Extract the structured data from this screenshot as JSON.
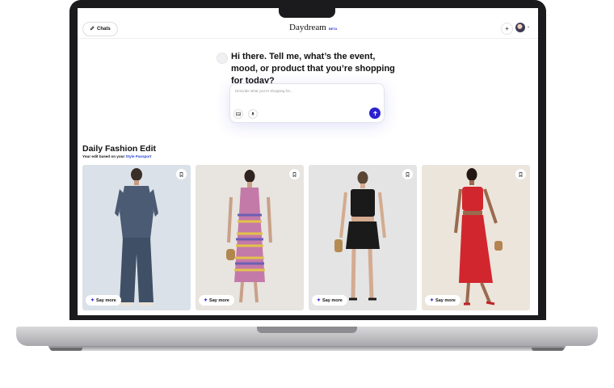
{
  "header": {
    "chats_label": "Chats",
    "brand": "Daydream",
    "beta_label": "BETA",
    "plus_label": "+",
    "avatar_caret": "⌄"
  },
  "hero": {
    "greeting": "Hi there. Tell me, what’s the event, mood, or product that you’re shopping for today?",
    "input_placeholder": "Describe what you’re shopping for..."
  },
  "section": {
    "title": "Daily Fashion Edit",
    "subtitle_prefix": "Your edit based on your ",
    "subtitle_link": "Style Passport"
  },
  "cards": [
    {
      "say_more": "Say more",
      "background": "#dbe1e8",
      "outfit": "denim-shirt-wide-jeans",
      "outfit_color": "#44546b"
    },
    {
      "say_more": "Say more",
      "background": "#e8e4df",
      "outfit": "striped-maxi-dress",
      "outfit_color": "#c47aa9"
    },
    {
      "say_more": "Say more",
      "background": "#e4e4e4",
      "outfit": "black-tank-and-shorts",
      "outfit_color": "#1a1a1a"
    },
    {
      "say_more": "Say more",
      "background": "#ece5dc",
      "outfit": "red-two-piece-set",
      "outfit_color": "#d2262e"
    }
  ],
  "colors": {
    "accent": "#2c22d0",
    "link": "#2c45d6",
    "bezel": "#1b1b1d"
  },
  "icons": {
    "chats": "pencil-icon",
    "bookmark": "bookmark-icon",
    "send": "arrow-up-icon",
    "image": "image-icon",
    "mic": "microphone-icon",
    "sparkle": "sparkle-icon"
  }
}
